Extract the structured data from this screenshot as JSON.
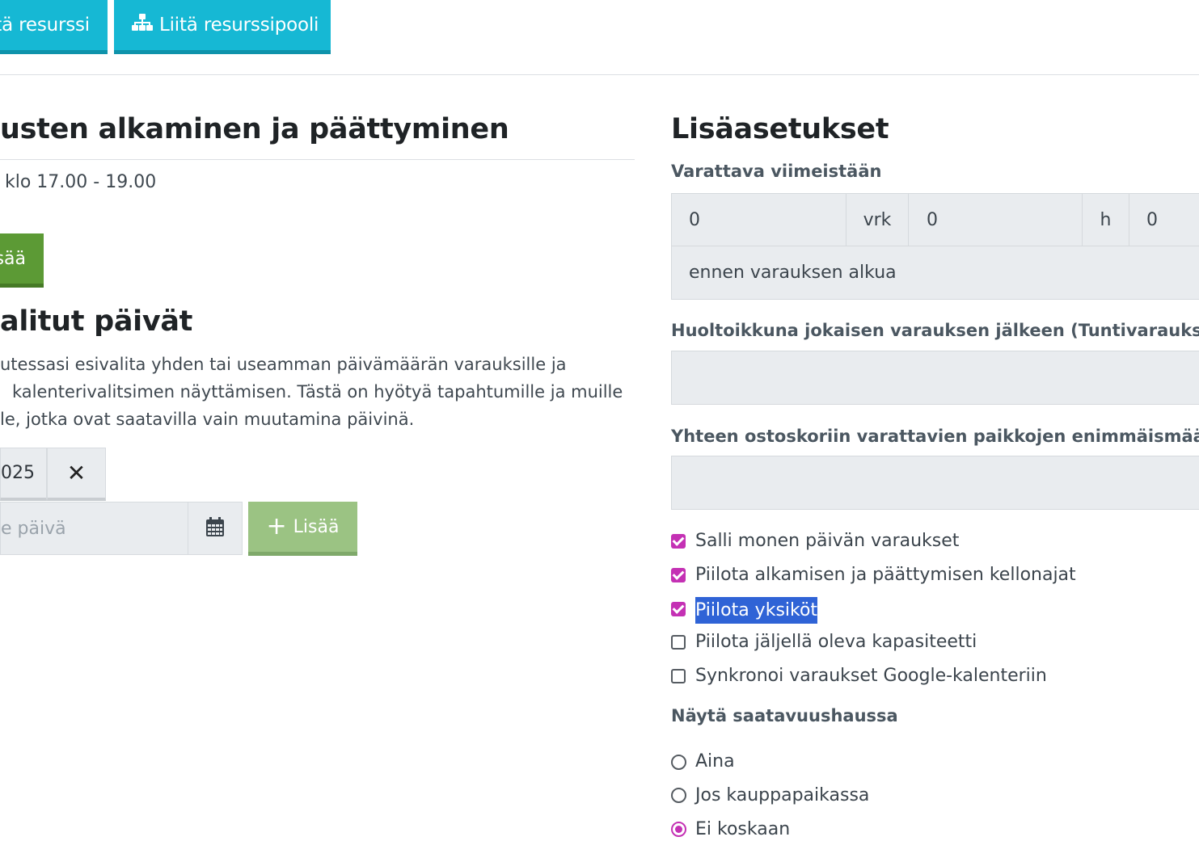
{
  "toolbar": {
    "resource_button": "tä resurssi",
    "pool_button": "Liitä resurssipooli",
    "pool_icon": "sitemap-icon"
  },
  "left": {
    "times_heading": "usten alkaminen ja päättyminen",
    "time_range": "klo 17.00 - 19.00",
    "add_time_button": "sää",
    "preselected_heading": "alitut päivät",
    "description_lines": [
      "utessasi esivalita yhden tai useamman päivämäärän varauksille ja",
      "kalenterivalitsimen näyttämisen. Tästä on hyötyä tapahtumille ja muille",
      "le, jotka ovat saatavilla vain muutamina päivinä."
    ],
    "existing_date": "025",
    "remove_icon": "close-icon",
    "new_date_placeholder": "e päivä",
    "calendar_icon": "calendar-icon",
    "add_date_button": "Lisää"
  },
  "right": {
    "heading": "Lisäasetukset",
    "deadline_label": "Varattava viimeistään",
    "deadline_days_value": "0",
    "deadline_days_unit": "vrk",
    "deadline_hours_value": "0",
    "deadline_hours_unit": "h",
    "deadline_minutes_value": "0",
    "deadline_suffix": "ennen varauksen alkua",
    "maintenance_label": "Huoltoikkuna jokaisen varauksen jälkeen (Tuntivaraukset",
    "maintenance_value": "",
    "max_spots_label": "Yhteen ostoskoriin varattavien paikkojen enimmäismäärä",
    "max_spots_value": "",
    "checkboxes": [
      {
        "label": "Salli monen päivän varaukset",
        "checked": true
      },
      {
        "label": "Piilota alkamisen ja päättymisen kellonajat",
        "checked": true
      },
      {
        "label": "Piilota yksiköt",
        "checked": true
      },
      {
        "label": "Piilota jäljellä oleva kapasiteetti",
        "checked": false
      },
      {
        "label": "Synkronoi varaukset Google-kalenteriin",
        "checked": false
      }
    ],
    "availability_label": "Näytä saatavuushaussa",
    "radios": [
      {
        "label": "Aina",
        "selected": false
      },
      {
        "label": "Jos kauppapaikassa",
        "selected": false
      },
      {
        "label": "Ei koskaan",
        "selected": true
      }
    ]
  },
  "colors": {
    "toolbar_button": "#16b8d4",
    "green_button": "#5c9a35",
    "accent_checkbox": "#c431b4",
    "selection_highlight": "#2f63d6"
  }
}
